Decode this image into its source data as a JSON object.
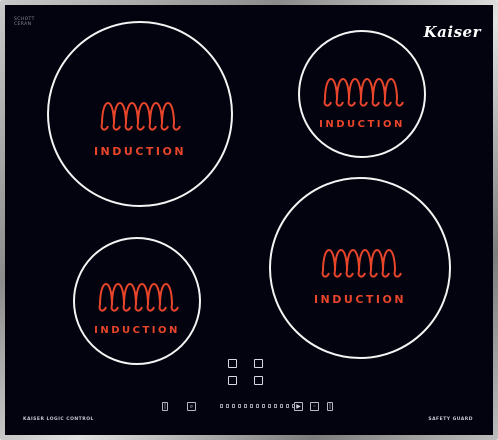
{
  "cooktop": {
    "brand": "Kaiser",
    "spec_text": [
      "SCHOTT",
      "CERAN"
    ],
    "footer_left": "KAISER LOGIC CONTROL",
    "footer_right": "SAFETY GUARD"
  },
  "zones": [
    {
      "label": "INDUCTION"
    },
    {
      "label": "INDUCTION"
    },
    {
      "label": "INDUCTION"
    },
    {
      "label": "INDUCTION"
    }
  ],
  "colors": {
    "glass": "#03030f",
    "zone_ring": "#f4f4f4",
    "coil": "#e8452b",
    "frame": "#a8a8a8"
  },
  "icons": [
    "zone-ring",
    "induction-coil-icon",
    "touch-pad",
    "power-icon",
    "timer-icon",
    "lock-icon",
    "play-icon",
    "minus-icon"
  ]
}
